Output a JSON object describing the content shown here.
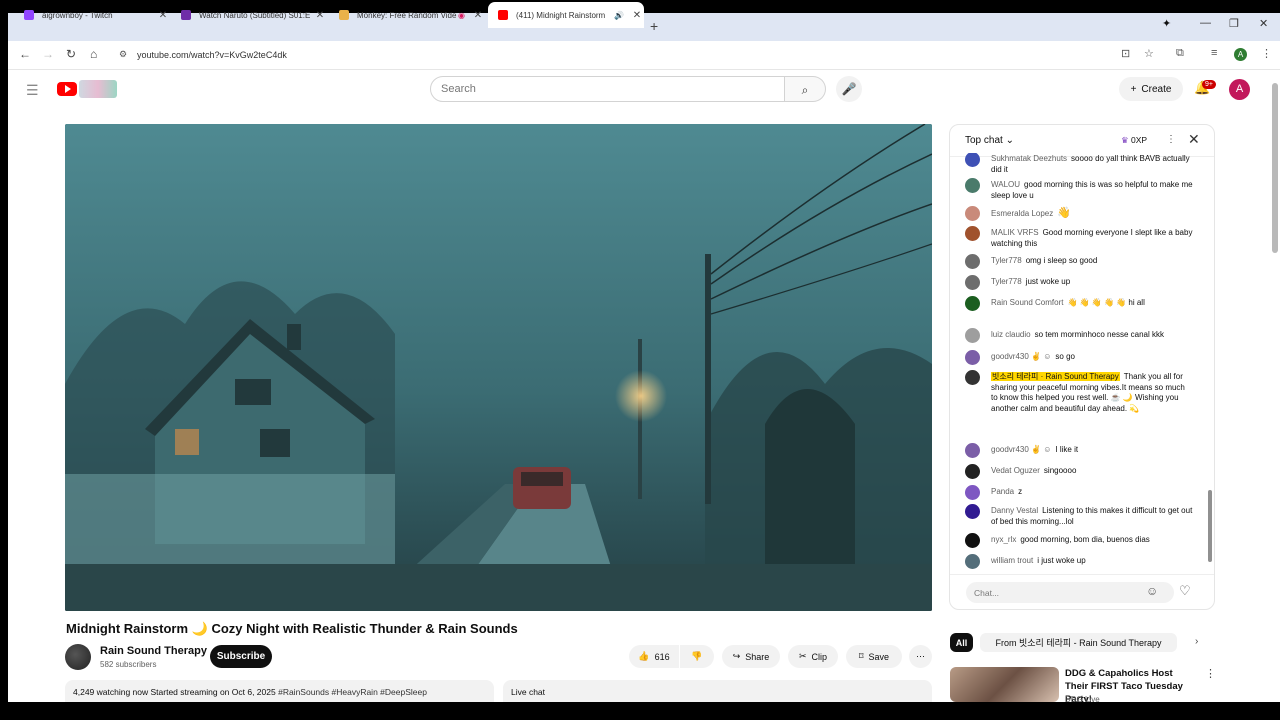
{
  "browser": {
    "tabs": [
      {
        "title": "aigrownboy - Twitch",
        "favicon_color": "#9146ff"
      },
      {
        "title": "Watch Naruto (Subtitled) S01:E",
        "favicon_color": "#6f2da8"
      },
      {
        "title": "Monkey: Free Random Vide",
        "favicon_color": "#e9b24a"
      },
      {
        "title": "(411) Midnight Rainstorm",
        "favicon_color": "#ff0000"
      }
    ],
    "url": "youtube.com/watch?v=KvGw2teC4dk",
    "profile_initial": "A"
  },
  "youtube_header": {
    "search_placeholder": "Search",
    "create_label": "Create",
    "notifications_badge": "9+",
    "avatar_initial": "A"
  },
  "video": {
    "title": "Midnight Rainstorm 🌙 Cozy Night with Realistic Thunder & Rain Sounds",
    "channel": "Rain Sound Therapy",
    "subscribers": "582 subscribers",
    "subscribe_label": "Subscribe",
    "likes": "616",
    "share_label": "Share",
    "clip_label": "Clip",
    "save_label": "Save",
    "description_stats": "4,249 watching now  Started streaming on Oct 6, 2025",
    "description_tags": "#RainSounds #HeavyRain #DeepSleep",
    "live_chat_label": "Live chat"
  },
  "chat": {
    "header": "Top chat",
    "xp": "0XP",
    "input_placeholder": "Chat...",
    "messages": [
      {
        "author": "Sukhmatak Deezhuts",
        "text": "soooo do yall think BAVB actually did it",
        "color": "#3f51b5"
      },
      {
        "author": "WALOU",
        "text": "good morning this is was so helpful to make me sleep love u",
        "color": "#4a7b6b"
      },
      {
        "author": "Esmeralda Lopez",
        "text": "👋",
        "color": "#c98a7a"
      },
      {
        "author": "MALIK VRFS",
        "text": "Good morning everyone I slept like a baby watching this",
        "color": "#a0522d"
      },
      {
        "author": "Tyler778",
        "text": "omg i sleep so good",
        "color": "#6d6d6d"
      },
      {
        "author": "Tyler778",
        "text": "just woke up",
        "color": "#6d6d6d"
      },
      {
        "author": "Rain Sound Comfort",
        "text": "👋 👋 👋 👋 👋  hi all",
        "color": "#1b5e20"
      },
      {
        "author": "luiz claudio",
        "text": "so tem morminhoco nesse canal kkk",
        "color": "#9e9e9e"
      },
      {
        "author": "goodvr430 ✌ ☺",
        "text": "so go",
        "color": "#7b5ea7"
      },
      {
        "author": "빗소리 테라피 · Rain Sound Therapy",
        "text": "Thank you all for sharing your peaceful morning vibes.It means so much to know this helped you rest well. ☕ 🌙 Wishing you another calm and beautiful day ahead. 💫",
        "color": "#333333"
      },
      {
        "author": "goodvr430 ✌ ☺",
        "text": "I like it",
        "color": "#7b5ea7"
      },
      {
        "author": "Vedat Oguzer",
        "text": "singoooo",
        "color": "#222222"
      },
      {
        "author": "Panda",
        "text": "z",
        "color": "#7e57c2"
      },
      {
        "author": "Danny Vestal",
        "text": "Listening to this makes it difficult to get out of bed this morning...lol",
        "color": "#311b92"
      },
      {
        "author": "nyx_rlx",
        "text": "good morning, bom dia, buenos dias",
        "color": "#111111"
      },
      {
        "author": "william trout",
        "text": "i just woke up",
        "color": "#546e7a"
      }
    ]
  },
  "recommendations": {
    "chips": [
      "All",
      "From 빗소리 테라피 - Rain Sound Therapy"
    ],
    "item": {
      "title": "DDG & Capaholics Host Their FIRST Taco Tuesday Party!",
      "meta": "DDG Live"
    }
  }
}
